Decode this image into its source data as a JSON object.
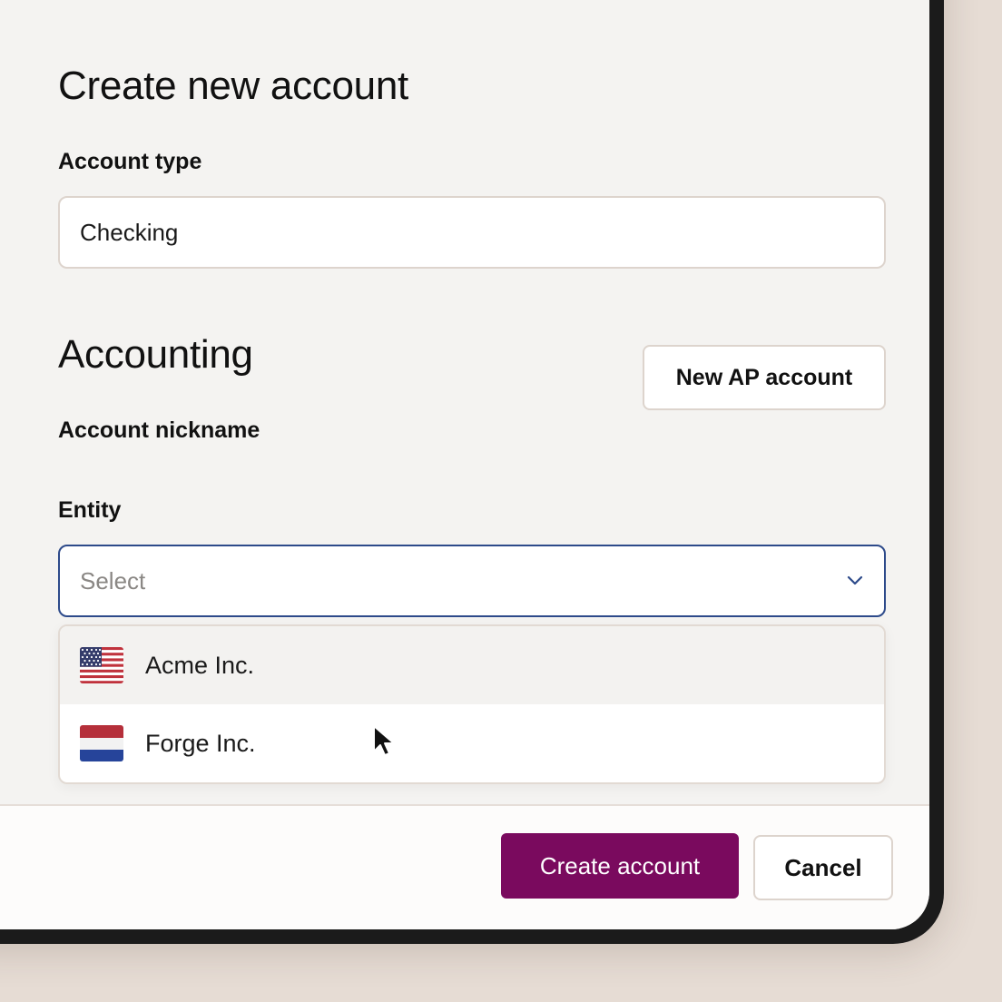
{
  "form": {
    "title": "Create new account",
    "account_type_label": "Account type",
    "account_type_value": "Checking"
  },
  "accounting": {
    "title": "Accounting",
    "nickname_label": "Account nickname",
    "new_ap_button": "New AP account",
    "entity_label": "Entity",
    "entity_placeholder": "Select",
    "options": [
      {
        "label": "Acme Inc.",
        "icon": "us-flag-icon"
      },
      {
        "label": "Forge Inc.",
        "icon": "netherlands-flag-icon"
      }
    ]
  },
  "footer": {
    "create_label": "Create account",
    "cancel_label": "Cancel"
  },
  "colors": {
    "primary": "#7a0a5e",
    "focus_border": "#2d4a8a",
    "background": "#e6dcd4"
  }
}
